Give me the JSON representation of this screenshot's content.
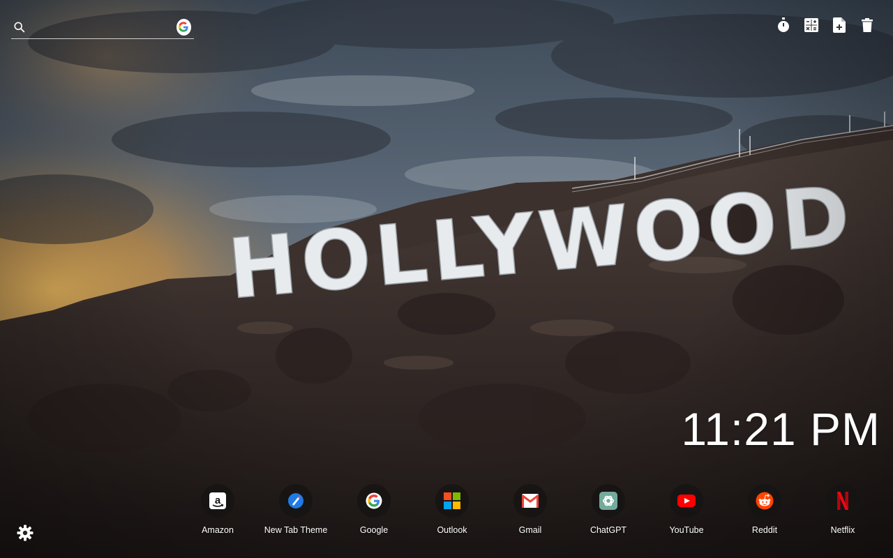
{
  "search": {
    "placeholder": "",
    "value": "",
    "search_icon": "search-icon",
    "engine_icon": "google-icon"
  },
  "toolbar": {
    "items": [
      {
        "name": "timer",
        "icon": "stopwatch-icon"
      },
      {
        "name": "calculator",
        "icon": "calculator-icon"
      },
      {
        "name": "add-note",
        "icon": "file-add-icon"
      },
      {
        "name": "trash",
        "icon": "trash-icon"
      }
    ]
  },
  "clock": {
    "time": "11:21 PM"
  },
  "background": {
    "sign_text": "HOLLYWOOD"
  },
  "shortcuts": [
    {
      "label": "Amazon",
      "icon": "amazon-icon"
    },
    {
      "label": "New Tab Theme",
      "icon": "new-tab-theme-icon"
    },
    {
      "label": "Google",
      "icon": "google-icon"
    },
    {
      "label": "Outlook",
      "icon": "microsoft-icon"
    },
    {
      "label": "Gmail",
      "icon": "gmail-icon"
    },
    {
      "label": "ChatGPT",
      "icon": "chatgpt-icon"
    },
    {
      "label": "YouTube",
      "icon": "youtube-icon"
    },
    {
      "label": "Reddit",
      "icon": "reddit-icon"
    },
    {
      "label": "Netflix",
      "icon": "netflix-icon"
    }
  ],
  "settings": {
    "icon": "gear-icon"
  },
  "colors": {
    "google_blue": "#4285F4",
    "google_red": "#EA4335",
    "google_yellow": "#FBBC05",
    "google_green": "#34A853",
    "youtube_red": "#FF0000",
    "reddit_orange": "#FF4500",
    "netflix_red": "#E50914",
    "chatgpt_teal": "#74AA9C"
  }
}
